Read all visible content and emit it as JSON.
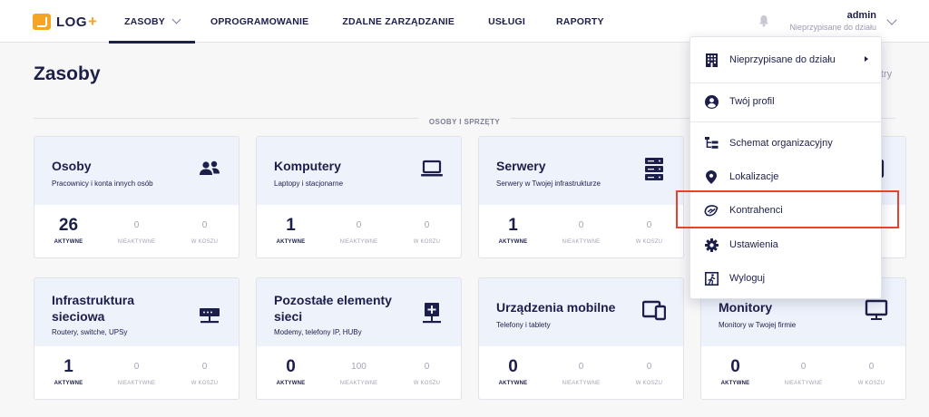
{
  "header": {
    "logo_text": "LOG",
    "logo_plus": "+",
    "nav": [
      {
        "label": "ZASOBY"
      },
      {
        "label": "OPROGRAMOWANIE"
      },
      {
        "label": "ZDALNE ZARZĄDZANIE"
      },
      {
        "label": "USŁUGI"
      },
      {
        "label": "RAPORTY"
      }
    ],
    "user_name": "admin",
    "user_department": "Nieprzypisane do działu"
  },
  "page": {
    "title": "Zasoby",
    "filters_label": "iltry",
    "section_label": "OSOBY I SPRZĘTY"
  },
  "cards": [
    {
      "title": "Osoby",
      "subtitle": "Pracownicy i konta innych osób",
      "icon": "people-icon",
      "stats": [
        "26",
        "0",
        "0"
      ]
    },
    {
      "title": "Komputery",
      "subtitle": "Laptopy i stacjonarne",
      "icon": "laptop-icon",
      "stats": [
        "1",
        "0",
        "0"
      ]
    },
    {
      "title": "Serwery",
      "subtitle": "Serwery w Twojej infrastrukturze",
      "icon": "server-icon",
      "stats": [
        "1",
        "0",
        "0"
      ]
    },
    {
      "title": "",
      "subtitle": "",
      "icon": "device-icon",
      "stats": [
        "",
        "",
        ""
      ]
    },
    {
      "title": "Infrastruktura sieciowa",
      "subtitle": "Routery, switche, UPSy",
      "icon": "network-icon",
      "stats": [
        "1",
        "0",
        "0"
      ]
    },
    {
      "title": "Pozostałe elementy sieci",
      "subtitle": "Modemy, telefony IP, HUBy",
      "icon": "network-plus-icon",
      "stats": [
        "0",
        "100",
        "0"
      ]
    },
    {
      "title": "Urządzenia mobilne",
      "subtitle": "Telefony i tablety",
      "icon": "mobile-devices-icon",
      "stats": [
        "0",
        "0",
        "0"
      ]
    },
    {
      "title": "Monitory",
      "subtitle": "Monitory w Twojej firmie",
      "icon": "monitor-icon",
      "stats": [
        "0",
        "0",
        "0"
      ]
    }
  ],
  "stat_labels": {
    "active": "AKTYWNE",
    "inactive": "NIEAKTYWNE",
    "trash": "W KOSZU"
  },
  "menu": {
    "items": [
      {
        "label": "Nieprzypisane do działu",
        "icon": "building-icon"
      },
      {
        "label": "Twój profil",
        "icon": "user-circle-icon"
      },
      {
        "label": "Schemat organizacyjny",
        "icon": "org-chart-icon"
      },
      {
        "label": "Lokalizacje",
        "icon": "location-pin-icon"
      },
      {
        "label": "Kontrahenci",
        "icon": "handshake-icon"
      },
      {
        "label": "Ustawienia",
        "icon": "gear-icon"
      },
      {
        "label": "Wyloguj",
        "icon": "logout-icon"
      }
    ]
  },
  "colors": {
    "primary": "#1c1f4a",
    "accent": "#f5a524",
    "card_header": "#eef2fb",
    "highlight": "#e8412c"
  }
}
